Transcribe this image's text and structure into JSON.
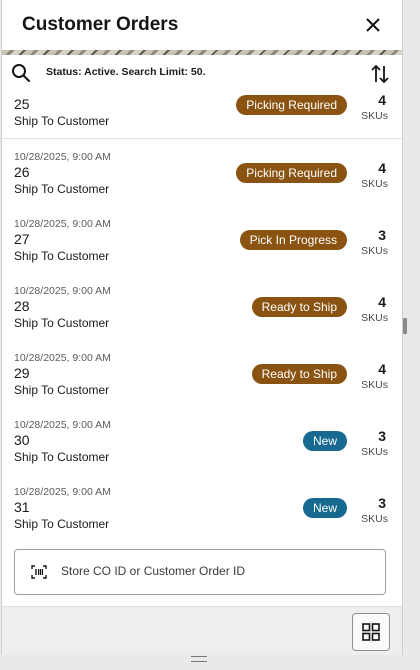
{
  "header": {
    "title": "Customer Orders"
  },
  "toolbar": {
    "status_text": "Status: Active. Search Limit: 50."
  },
  "orders": [
    {
      "date": "",
      "number": "25",
      "type": "Ship To Customer",
      "status": "Picking Required",
      "status_color": "#8a5311",
      "sku_count": "4",
      "sku_label": "SKUs"
    },
    {
      "date": "10/28/2025, 9:00 AM",
      "number": "26",
      "type": "Ship To Customer",
      "status": "Picking Required",
      "status_color": "#8a5311",
      "sku_count": "4",
      "sku_label": "SKUs"
    },
    {
      "date": "10/28/2025, 9:00 AM",
      "number": "27",
      "type": "Ship To Customer",
      "status": "Pick In Progress",
      "status_color": "#8a5311",
      "sku_count": "3",
      "sku_label": "SKUs"
    },
    {
      "date": "10/28/2025, 9:00 AM",
      "number": "28",
      "type": "Ship To Customer",
      "status": "Ready to Ship",
      "status_color": "#8a5311",
      "sku_count": "4",
      "sku_label": "SKUs"
    },
    {
      "date": "10/28/2025, 9:00 AM",
      "number": "29",
      "type": "Ship To Customer",
      "status": "Ready to Ship",
      "status_color": "#8a5311",
      "sku_count": "4",
      "sku_label": "SKUs"
    },
    {
      "date": "10/28/2025, 9:00 AM",
      "number": "30",
      "type": "Ship To Customer",
      "status": "New",
      "status_color": "#17698f",
      "sku_count": "3",
      "sku_label": "SKUs"
    },
    {
      "date": "10/28/2025, 9:00 AM",
      "number": "31",
      "type": "Ship To Customer",
      "status": "New",
      "status_color": "#17698f",
      "sku_count": "3",
      "sku_label": "SKUs"
    }
  ],
  "scan": {
    "placeholder": "Store CO ID or Customer Order ID"
  },
  "icons": {
    "close": "close-icon",
    "search": "search-icon",
    "sort": "sort-icon",
    "barcode": "barcode-scan-icon",
    "grid": "grid-view-icon"
  },
  "colors": {
    "status_brown": "#8a5311",
    "status_blue": "#17698f"
  }
}
